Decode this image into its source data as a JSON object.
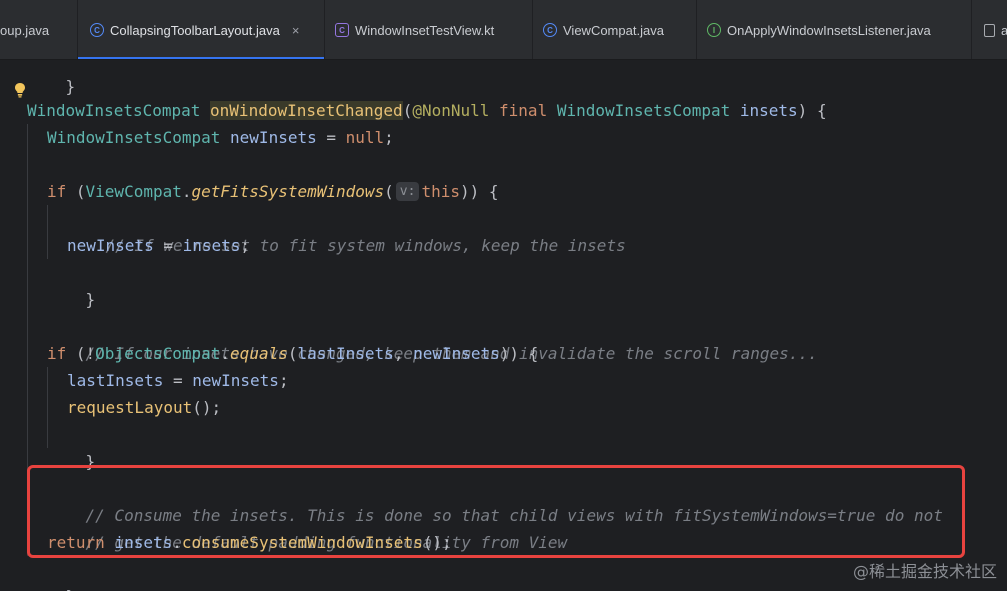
{
  "tabs": [
    {
      "label": "oup.java",
      "icon": "java-class-icon",
      "active": false
    },
    {
      "label": "CollapsingToolbarLayout.java",
      "icon": "java-class-icon",
      "active": true,
      "close": "×"
    },
    {
      "label": "WindowInsetTestView.kt",
      "icon": "kotlin-class-icon",
      "active": false
    },
    {
      "label": "ViewCompat.java",
      "icon": "java-class-icon",
      "active": false
    },
    {
      "label": "OnApplyWindowInsetsListener.java",
      "icon": "java-interface-icon",
      "active": false
    },
    {
      "label": "a",
      "icon": "file-icon",
      "active": false
    }
  ],
  "code": {
    "l0": "}",
    "l1": {
      "t1": "WindowInsetsCompat",
      "t2": "onWindowInsetChanged",
      "t3": "(",
      "t4": "@NonNull",
      "t5": "final",
      "t6": "WindowInsetsCompat",
      "t7": "insets",
      "t8": ") {"
    },
    "l2": {
      "t1": "WindowInsetsCompat",
      "t2": "newInsets",
      "t3": " = ",
      "t4": "null",
      "t5": ";"
    },
    "l4": {
      "t1": "if",
      "t2": " (",
      "t3": "ViewCompat",
      "t4": ".",
      "t5": "getFitsSystemWindows",
      "t6": "(",
      "hint": "v:",
      "t7": "this",
      "t8": ")) {"
    },
    "l5": "// If we're set to fit system windows, keep the insets",
    "l6": {
      "t1": "newInsets",
      "t2": " = ",
      "t3": "insets",
      "t4": ";"
    },
    "l7": "}",
    "l9": "// If our insets have changed, keep them and invalidate the scroll ranges...",
    "l10": {
      "t1": "if",
      "t2": " (!",
      "t3": "ObjectsCompat",
      "t4": ".",
      "t5": "equals",
      "t6": "(",
      "t7": "lastInsets",
      "t8": ", ",
      "t9": "newInsets",
      "t10": ")) {"
    },
    "l11": {
      "t1": "lastInsets",
      "t2": " = ",
      "t3": "newInsets",
      "t4": ";"
    },
    "l12": {
      "t1": "requestLayout",
      "t2": "();"
    },
    "l13": "}",
    "l15": "// Consume the insets. This is done so that child views with fitSystemWindows=true do not",
    "l16": "// get the default padding functionality from View",
    "l17": {
      "t1": "return",
      "t2": " ",
      "t3": "insets",
      "t4": ".",
      "t5": "consumeSystemWindowInsets",
      "t6": "();"
    },
    "l18": "}"
  },
  "watermark": "@稀土掘金技术社区",
  "colors": {
    "background": "#1e1f22",
    "tab_bar": "#2b2d30",
    "active_tab_underline": "#3574f0",
    "highlight_box": "#e8433f",
    "keyword": "#cf8e6d",
    "type": "#5fb5ae",
    "comment": "#7a7e85",
    "method_call": "#56a8f5"
  }
}
